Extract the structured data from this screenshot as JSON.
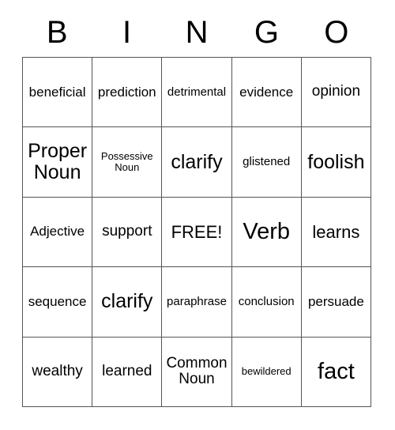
{
  "card": {
    "title": "BINGO",
    "header_letters": [
      "B",
      "I",
      "N",
      "G",
      "O"
    ],
    "columns": 5,
    "rows": 5,
    "border_color": "#555555",
    "text_color": "#000000",
    "background_color": "#ffffff",
    "free_space": "FREE!",
    "cells": [
      [
        {
          "text": "beneficial",
          "size": "m"
        },
        {
          "text": "prediction",
          "size": "m"
        },
        {
          "text": "detrimental",
          "size": "s"
        },
        {
          "text": "evidence",
          "size": "m"
        },
        {
          "text": "opinion",
          "size": "l"
        }
      ],
      [
        {
          "text": "Proper\nNoun",
          "size": "xxl"
        },
        {
          "text": "Possessive\nNoun",
          "size": "xs"
        },
        {
          "text": "clarify",
          "size": "xxl"
        },
        {
          "text": "glistened",
          "size": "s"
        },
        {
          "text": "foolish",
          "size": "xxl"
        }
      ],
      [
        {
          "text": "Adjective",
          "size": "m"
        },
        {
          "text": "support",
          "size": "l"
        },
        {
          "text": "FREE!",
          "size": "xl"
        },
        {
          "text": "Verb",
          "size": "3xl"
        },
        {
          "text": "learns",
          "size": "xl"
        }
      ],
      [
        {
          "text": "sequence",
          "size": "m"
        },
        {
          "text": "clarify",
          "size": "xxl"
        },
        {
          "text": "paraphrase",
          "size": "s"
        },
        {
          "text": "conclusion",
          "size": "s"
        },
        {
          "text": "persuade",
          "size": "m"
        }
      ],
      [
        {
          "text": "wealthy",
          "size": "l"
        },
        {
          "text": "learned",
          "size": "l"
        },
        {
          "text": "Common\nNoun",
          "size": "l"
        },
        {
          "text": "bewildered",
          "size": "xs"
        },
        {
          "text": "fact",
          "size": "3xl"
        }
      ]
    ]
  }
}
